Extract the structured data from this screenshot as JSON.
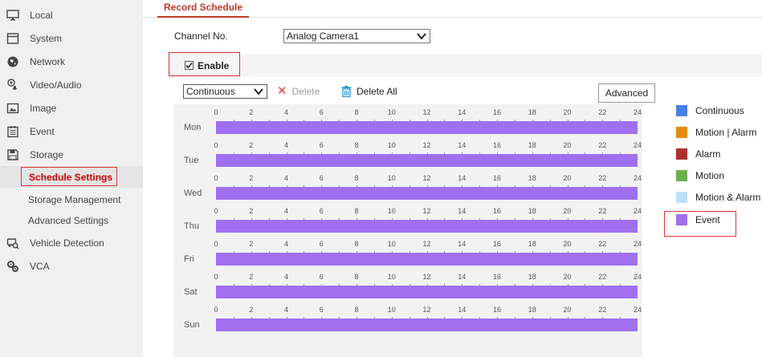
{
  "sidebar": {
    "items": [
      {
        "label": "Local",
        "icon": "monitor-icon"
      },
      {
        "label": "System",
        "icon": "window-icon"
      },
      {
        "label": "Network",
        "icon": "globe-icon"
      },
      {
        "label": "Video/Audio",
        "icon": "camera-mic-icon"
      },
      {
        "label": "Image",
        "icon": "image-icon"
      },
      {
        "label": "Event",
        "icon": "calendar-icon"
      },
      {
        "label": "Storage",
        "icon": "floppy-disk-icon"
      }
    ],
    "subitems": [
      {
        "label": "Schedule Settings",
        "active": true
      },
      {
        "label": "Storage Management",
        "active": false
      },
      {
        "label": "Advanced Settings",
        "active": false
      }
    ],
    "items_after": [
      {
        "label": "Vehicle Detection",
        "icon": "vehicle-search-icon"
      },
      {
        "label": "VCA",
        "icon": "gears-icon"
      }
    ]
  },
  "tabs": {
    "record_schedule": "Record Schedule"
  },
  "channel": {
    "label": "Channel No.",
    "value": "Analog Camera1"
  },
  "enable": {
    "label": "Enable",
    "checked": true
  },
  "toolbar": {
    "mode_value": "Continuous",
    "delete_label": "Delete",
    "delete_all_label": "Delete All",
    "advanced_label": "Advanced"
  },
  "schedule": {
    "tick_labels": [
      "0",
      "2",
      "4",
      "6",
      "8",
      "10",
      "12",
      "14",
      "16",
      "18",
      "20",
      "22",
      "24"
    ],
    "days": [
      {
        "label": "Mon",
        "type": "Event",
        "start": 0,
        "end": 24
      },
      {
        "label": "Tue",
        "type": "Event",
        "start": 0,
        "end": 24
      },
      {
        "label": "Wed",
        "type": "Event",
        "start": 0,
        "end": 24
      },
      {
        "label": "Thu",
        "type": "Event",
        "start": 0,
        "end": 24
      },
      {
        "label": "Fri",
        "type": "Event",
        "start": 0,
        "end": 24
      },
      {
        "label": "Sat",
        "type": "Event",
        "start": 0,
        "end": 24
      },
      {
        "label": "Sun",
        "type": "Event",
        "start": 0,
        "end": 24
      }
    ]
  },
  "legend": [
    {
      "label": "Continuous",
      "color": "#4a7fe0"
    },
    {
      "label": "Motion | Alarm",
      "color": "#e88a10"
    },
    {
      "label": "Alarm",
      "color": "#b03030"
    },
    {
      "label": "Motion",
      "color": "#6ab04c"
    },
    {
      "label": "Motion & Alarm",
      "color": "#bde0f5"
    },
    {
      "label": "Event",
      "color": "#a070f0"
    }
  ],
  "colors": {
    "accent": "#c0392b",
    "event": "#a070f0"
  }
}
